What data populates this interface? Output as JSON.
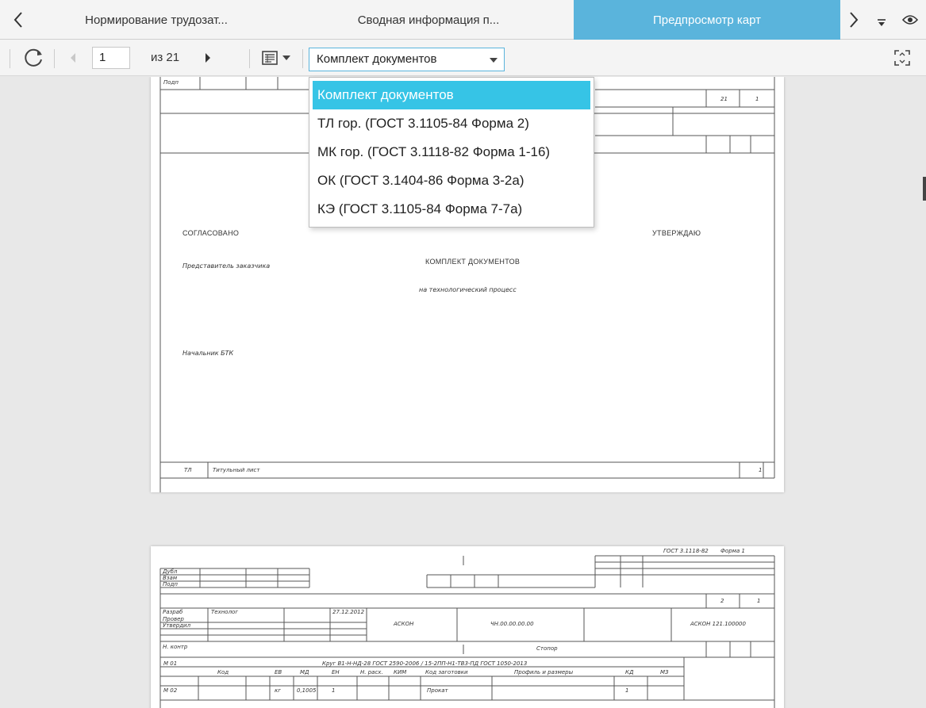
{
  "tabs": {
    "items": [
      {
        "label": "Нормирование трудозат..."
      },
      {
        "label": "Сводная информация п..."
      },
      {
        "label": "Предпросмотр карт"
      }
    ]
  },
  "toolbar": {
    "page_value": "1",
    "of_label": "из 21",
    "set_selected": "Комплект документов"
  },
  "dropdown": {
    "options": [
      "Комплект документов",
      "ТЛ гор. (ГОСТ 3.1105-84 Форма 2)",
      "МК гор. (ГОСТ 3.1118-82 Форма 1-16)",
      "ОК (ГОСТ 3.1404-86 Форма 3-2а)",
      "КЭ (ГОСТ 3.1105-84 Форма 7-7а)"
    ]
  },
  "sheet1": {
    "podp": "Подп",
    "sheet_no": "21",
    "sheet_one": "1",
    "agreed": "СОГЛАСОВАНО",
    "approved": "УТВЕРЖДАЮ",
    "customer_rep": "Представитель заказчика",
    "doc_title": "КОМПЛЕКТ ДОКУМЕНТОВ",
    "doc_subtitle": "на технологический процесс",
    "btk_head": "Начальник БТК",
    "tl": "ТЛ",
    "title_sheet": "Титульный лист",
    "page": "1"
  },
  "sheet2": {
    "gost": "ГОСТ 3.1118-82",
    "form": "Форма 1",
    "dubl": "Дубл",
    "vzam": "Взам",
    "podp": "Подп",
    "two": "2",
    "one": "1",
    "razrab": "Разраб",
    "tech": "Технолог",
    "date": "27.12.2012",
    "prover": "Провер",
    "utverd": "Утвердил",
    "nkontr": "Н. контр",
    "org": "АСКОН",
    "code": "ЧН.00.00.00.00",
    "code2": "АСКОН 121.100000",
    "detail": "Стопор",
    "m01": "М 01",
    "material": "Круг В1-Н-НД-28 ГОСТ 2590-2006 / 15-2ПП-Н1-ТВ3-ПД ГОСТ 1050-2013",
    "h_code": "Код",
    "h_ev": "ЕВ",
    "h_md": "МД",
    "h_en": "ЕН",
    "h_nrasx": "Н. расх.",
    "h_kim": "КИМ",
    "h_zagot": "Код заготовки",
    "h_profile": "Профиль и размеры",
    "h_kd": "КД",
    "h_mz": "МЗ",
    "m02": "М 02",
    "v_kg": "кг",
    "v_md": "0,1005",
    "v_en": "1",
    "v_zag": "Прокат",
    "v_kd": "1"
  }
}
